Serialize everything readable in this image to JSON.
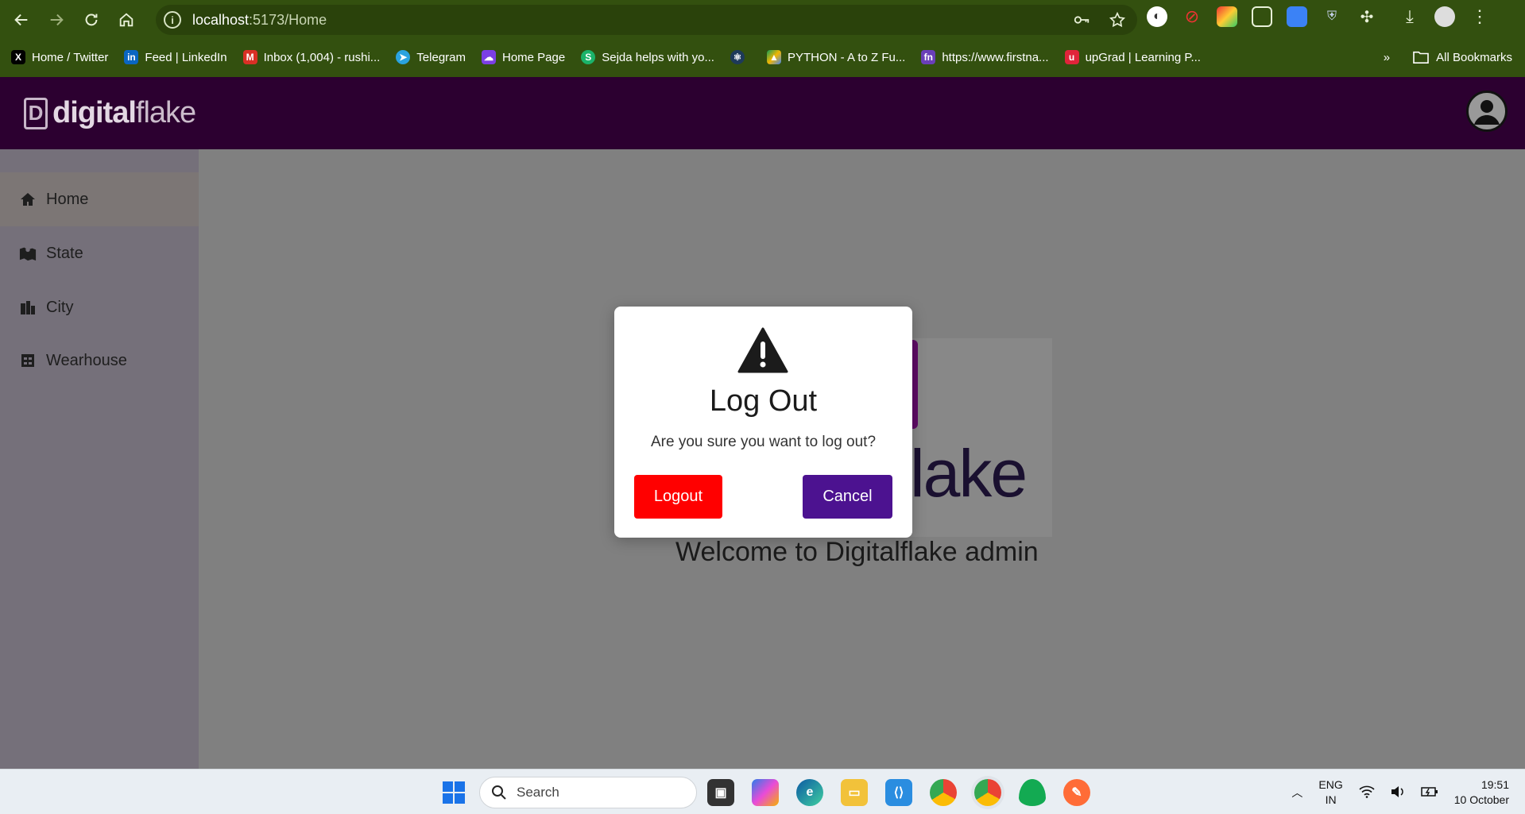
{
  "browser": {
    "url_host": "localhost",
    "url_path": ":5173/Home",
    "bookmarks": [
      {
        "label": "Home / Twitter",
        "icon": "x-icon",
        "color": "#000000"
      },
      {
        "label": "Feed | LinkedIn",
        "icon": "linkedin-icon",
        "color": "#0a66c2"
      },
      {
        "label": "Inbox (1,004) - rushi...",
        "icon": "gmail-icon",
        "color": "#d93025"
      },
      {
        "label": "Telegram",
        "icon": "telegram-icon",
        "color": "#2aa3e0"
      },
      {
        "label": "Home Page",
        "icon": "cloud-icon",
        "color": "#7b3fe4"
      },
      {
        "label": "Sejda helps with yo...",
        "icon": "sejda-icon",
        "color": "#1bb36a"
      },
      {
        "label": "",
        "icon": "react-icon",
        "color": "#1e3a5a"
      },
      {
        "label": "PYTHON - A to Z Fu...",
        "icon": "drive-icon",
        "color": "#f2b600"
      },
      {
        "label": "https://www.firstna...",
        "icon": "fn-icon",
        "color": "#6a3fb8"
      },
      {
        "label": "upGrad | Learning P...",
        "icon": "upgrad-icon",
        "color": "#e0243a"
      }
    ],
    "all_bookmarks": "All Bookmarks"
  },
  "app": {
    "logo_prefix": "digital",
    "logo_suffix": "flake",
    "logo_mark": "D"
  },
  "sidebar": {
    "items": [
      {
        "label": "Home",
        "icon": "home-icon",
        "active": true
      },
      {
        "label": "State",
        "icon": "map-icon",
        "active": false
      },
      {
        "label": "City",
        "icon": "city-icon",
        "active": false
      },
      {
        "label": "Wearhouse",
        "icon": "warehouse-icon",
        "active": false
      }
    ]
  },
  "main": {
    "hero_text": "lake",
    "welcome": "Welcome to Digitalflake admin"
  },
  "modal": {
    "title": "Log Out",
    "message": "Are you sure you want to log out?",
    "logout_label": "Logout",
    "cancel_label": "Cancel"
  },
  "taskbar": {
    "search_placeholder": "Search",
    "lang_line1": "ENG",
    "lang_line2": "IN",
    "time": "19:51",
    "date": "10 October"
  },
  "colors": {
    "header": "#2c0030",
    "chrome": "#33500f",
    "logout": "#ff0000",
    "cancel": "#4c1290"
  }
}
